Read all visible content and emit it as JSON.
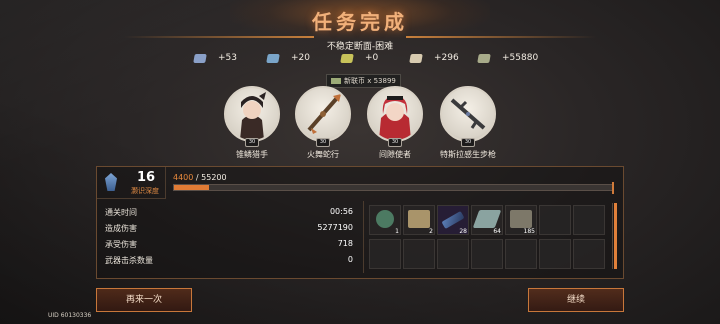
{
  "title": "任务完成",
  "subtitle": "不稳定断面-困难",
  "resources": [
    {
      "icon": "gear-box-icon",
      "value": "+53",
      "color": "#8aa0c8"
    },
    {
      "icon": "crystal-icon",
      "value": "+20",
      "color": "#7aa5c9"
    },
    {
      "icon": "chip-icon",
      "value": "+0",
      "color": "#c8c35a"
    },
    {
      "icon": "ticket-icon",
      "value": "+296",
      "color": "#d8cbb0"
    },
    {
      "icon": "cash-icon",
      "value": "+55880",
      "color": "#a8ab8a"
    }
  ],
  "coin_tag": "新联币 x 53899",
  "characters": [
    {
      "name": "锥鳞猎手",
      "level": "30"
    },
    {
      "name": "火舞蛇行",
      "level": "30"
    },
    {
      "name": "间隙使者",
      "level": "30"
    },
    {
      "name": "特斯拉感生步枪",
      "level": "30"
    }
  ],
  "depth": {
    "value": "16",
    "label": "灏识深度"
  },
  "xp": {
    "current": "4400",
    "separator": " / ",
    "max": "55200",
    "progress": 0.0797
  },
  "stats": [
    {
      "label": "通关时间",
      "value": "00:56"
    },
    {
      "label": "造成伤害",
      "value": "5277190"
    },
    {
      "label": "承受伤害",
      "value": "718"
    },
    {
      "label": "武器击杀数量",
      "value": "0"
    }
  ],
  "items": [
    {
      "count": "1",
      "icon": "badge-icon",
      "color": "#4c7a62"
    },
    {
      "count": "2",
      "icon": "map-icon",
      "color": "#a9946a"
    },
    {
      "count": "28",
      "icon": "syringe-icon",
      "color": "#5b7fb8"
    },
    {
      "count": "64",
      "icon": "metal-plate-icon",
      "color": "#8aa3a0"
    },
    {
      "count": "185",
      "icon": "board-icon",
      "color": "#7d7869"
    }
  ],
  "buttons": {
    "retry": "再来一次",
    "continue": "继续"
  },
  "uid": "UID 60130336"
}
